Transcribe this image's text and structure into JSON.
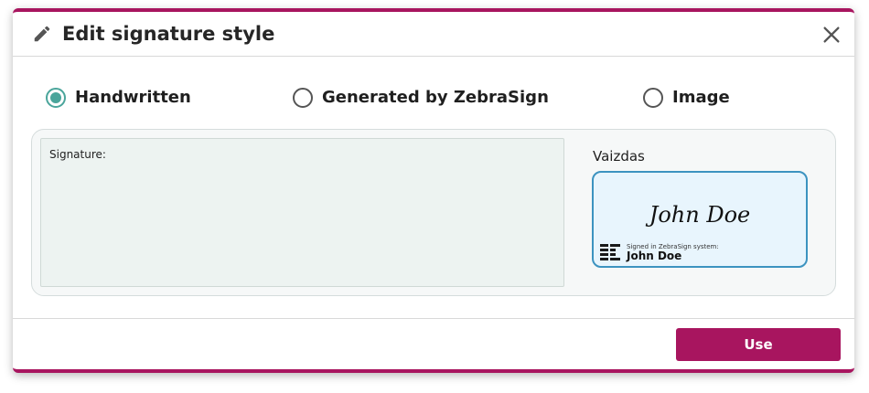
{
  "dialog": {
    "title": "Edit signature style",
    "icons": {
      "title_icon": "pencil-icon",
      "close_icon": "close-icon"
    }
  },
  "style_options": [
    {
      "label": "Handwritten",
      "selected": true
    },
    {
      "label": "Generated by ZebraSign",
      "selected": false
    },
    {
      "label": "Image",
      "selected": false
    }
  ],
  "signature_pad": {
    "label": "Signature:"
  },
  "preview": {
    "label": "Vaizdas",
    "signature_text": "John Doe",
    "stamp_caption": "Signed in ZebraSign system:",
    "stamp_name": "John Doe",
    "logo_icon": "zebrasign-logo-icon"
  },
  "footer": {
    "use_label": "Use"
  },
  "colors": {
    "accent": "#a8155f",
    "radio_selected": "#4aa59b",
    "preview_border": "#3c93c0",
    "preview_background": "#e8f5fd",
    "signature_pad_background": "#edf3f1"
  }
}
